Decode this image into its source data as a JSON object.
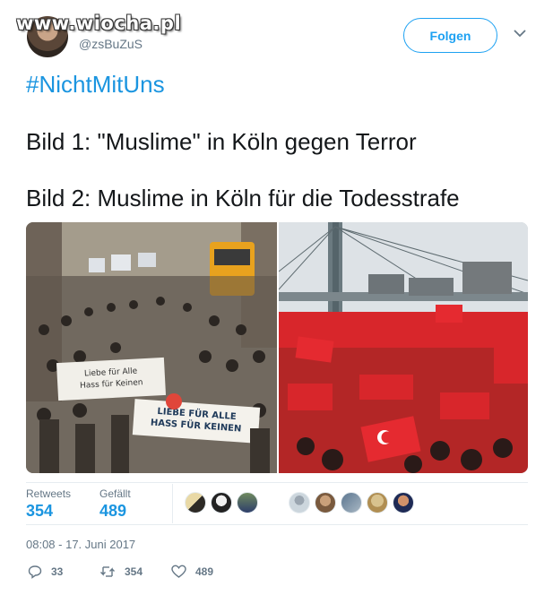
{
  "watermark": "www.wiocha.pl",
  "user": {
    "handle": "@zsBuZuS"
  },
  "follow_label": "Folgen",
  "tweet": {
    "hashtag": "#NichtMitUns",
    "line1": "Bild 1: \"Muslime\" in Köln gegen Terror",
    "line2": "Bild 2: Muslime in Köln für die Todesstrafe"
  },
  "media": {
    "photo1": {
      "banner_text_1": "LIEBE FÜR ALLE",
      "banner_text_2": "HASS FÜR KEINEN"
    },
    "photo2": {}
  },
  "stats": {
    "retweets_label": "Retweets",
    "retweets_value": "354",
    "likes_label": "Gefällt",
    "likes_value": "489"
  },
  "timestamp": "08:08 - 17. Juni 2017",
  "actions": {
    "reply_count": "33",
    "retweet_count": "354",
    "like_count": "489"
  },
  "colors": {
    "accent": "#1da1f2",
    "link": "#1b95e0",
    "muted": "#657786",
    "text": "#14171a"
  },
  "icons": [
    "chevron-down-icon",
    "reply-icon",
    "retweet-icon",
    "heart-icon"
  ]
}
